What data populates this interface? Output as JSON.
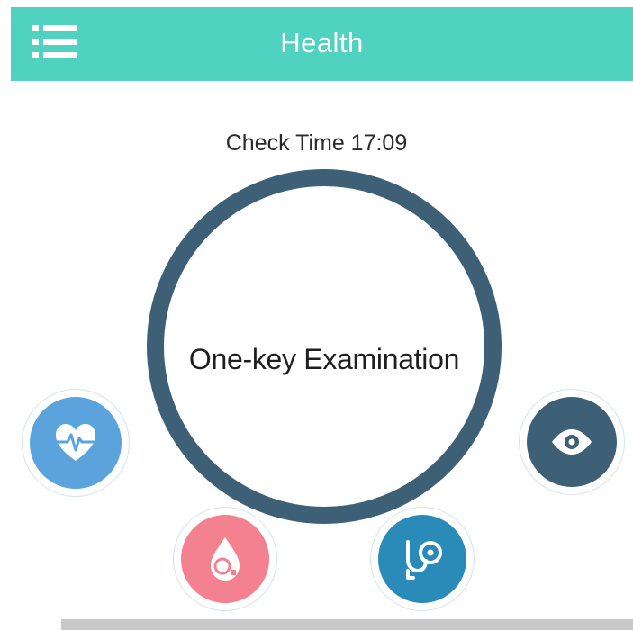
{
  "header": {
    "title": "Health",
    "menu_icon": "list-menu-icon",
    "background_color": "#4fd2bf"
  },
  "check": {
    "label": "Check Time 17:09"
  },
  "exam": {
    "label": "One-key Examination",
    "ring_color": "#3d6076"
  },
  "features": [
    {
      "name": "heart-rate",
      "icon": "heart-pulse-icon",
      "color": "#5aa3dc"
    },
    {
      "name": "blood-oxygen",
      "icon": "oxygen-drop-icon",
      "color": "#f4818f"
    },
    {
      "name": "blood-pressure",
      "icon": "stethoscope-icon",
      "color": "#2b8bb8"
    },
    {
      "name": "eye-care",
      "icon": "eye-icon",
      "color": "#3d6076"
    }
  ]
}
